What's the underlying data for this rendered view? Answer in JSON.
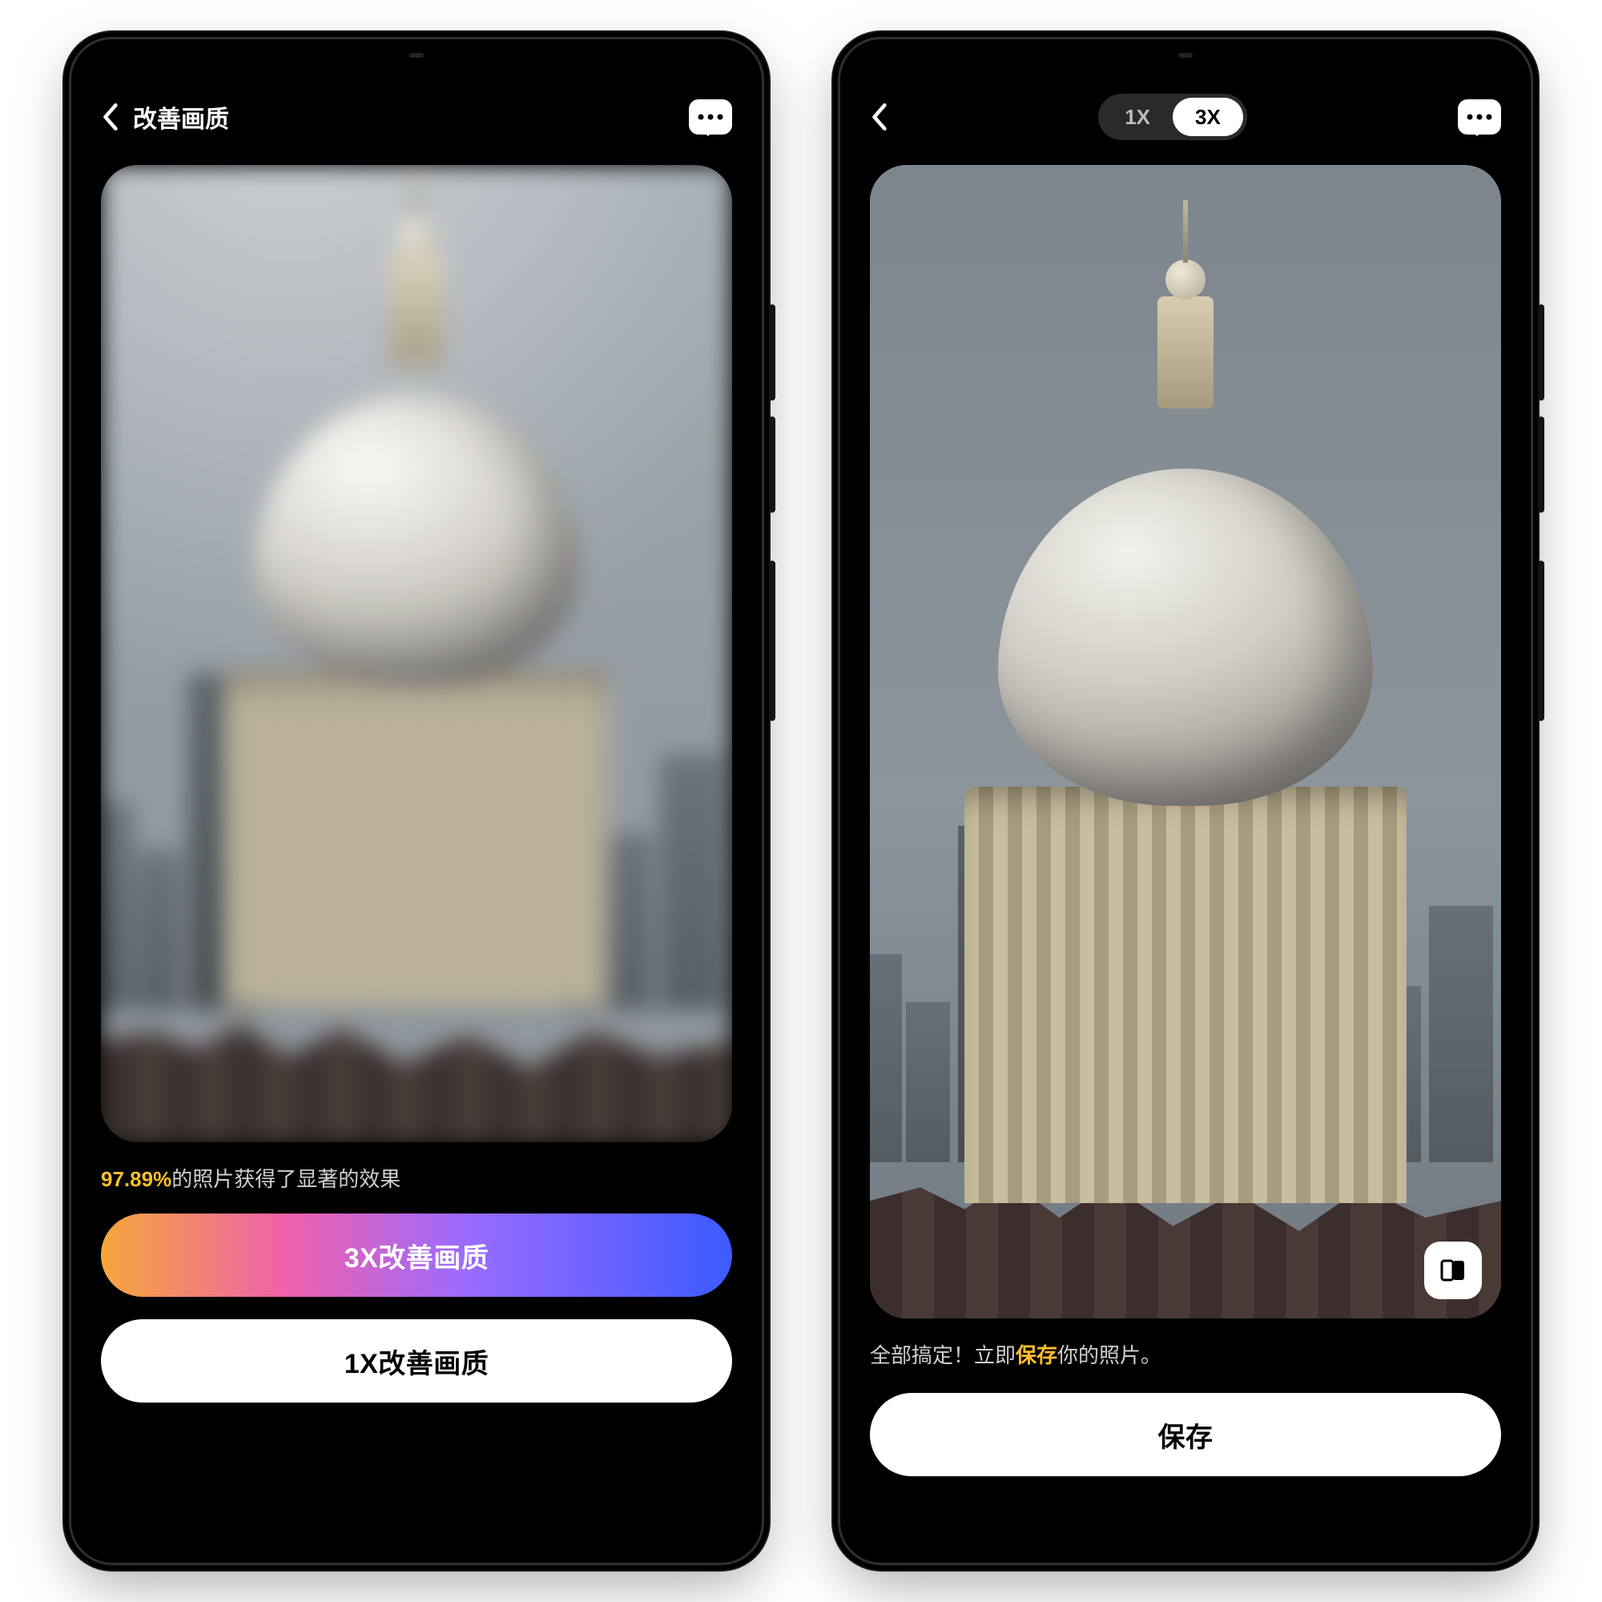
{
  "phone1": {
    "header": {
      "title": "改善画质"
    },
    "caption": {
      "percent": "97.89%",
      "rest": "的照片获得了显著的效果"
    },
    "buttons": {
      "primary": "3X改善画质",
      "secondary": "1X改善画质"
    }
  },
  "phone2": {
    "segmented": {
      "opt1": "1X",
      "opt2": "3X",
      "active": "3X"
    },
    "caption": {
      "pre": "全部搞定！立即",
      "strong": "保存",
      "post": "你的照片。"
    },
    "button": "保存"
  }
}
